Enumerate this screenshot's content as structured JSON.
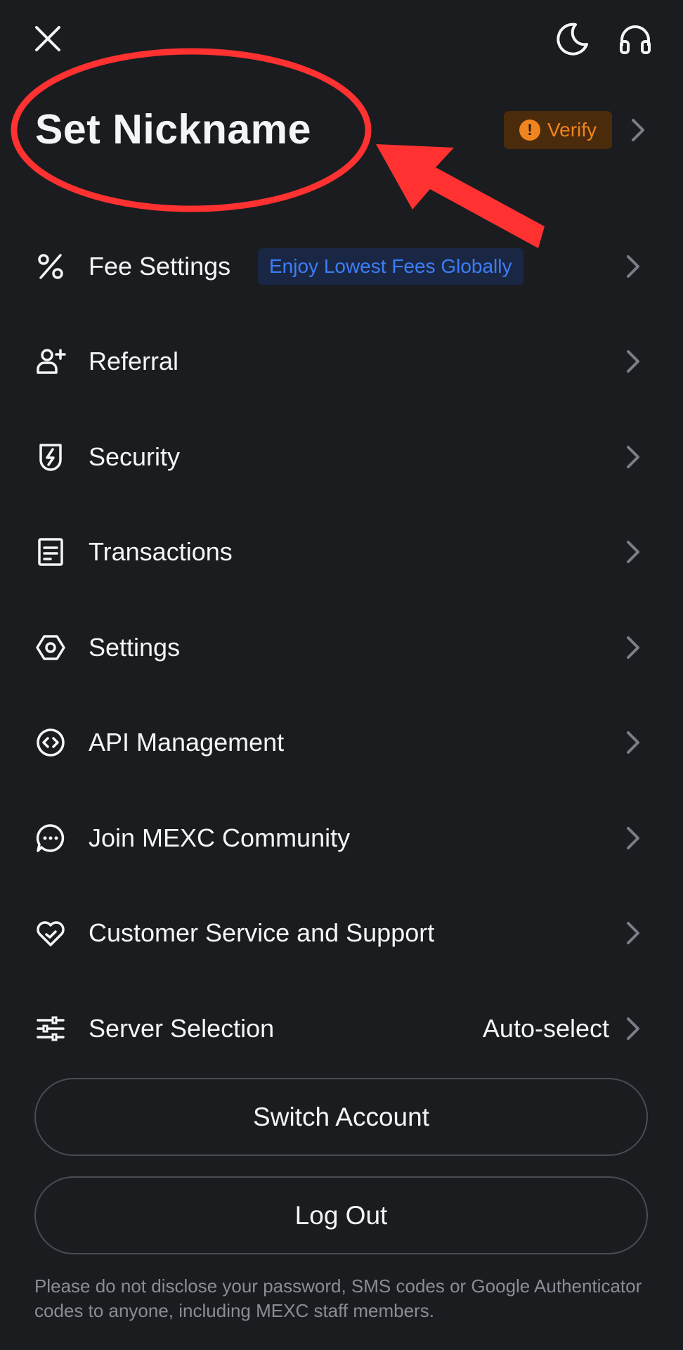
{
  "header": {
    "close_icon": "close-icon",
    "theme_icon": "moon-icon",
    "support_icon": "headphones-icon"
  },
  "profile": {
    "title": "Set Nickname",
    "verify_label": "Verify",
    "verify_color": "#f0841e"
  },
  "menu": {
    "fee_settings": {
      "label": "Fee Settings",
      "badge": "Enjoy Lowest Fees Globally",
      "icon": "percent-icon"
    },
    "referral": {
      "label": "Referral",
      "icon": "add-user-icon"
    },
    "security": {
      "label": "Security",
      "icon": "shield-bolt-icon"
    },
    "transactions": {
      "label": "Transactions",
      "icon": "document-icon"
    },
    "settings": {
      "label": "Settings",
      "icon": "hexagon-gear-icon"
    },
    "api_management": {
      "label": "API Management",
      "icon": "code-circle-icon"
    },
    "community": {
      "label": "Join MEXC Community",
      "icon": "chat-bubble-icon"
    },
    "customer_service": {
      "label": "Customer Service and Support",
      "icon": "heart-icon"
    },
    "server_selection": {
      "label": "Server Selection",
      "value": "Auto-select",
      "icon": "sliders-icon"
    }
  },
  "actions": {
    "switch_account": "Switch Account",
    "log_out": "Log Out"
  },
  "disclaimer": "Please do not disclose your password, SMS codes or Google Authenticator codes to anyone, including MEXC staff members.",
  "annotation": {
    "color": "#ff3131"
  }
}
